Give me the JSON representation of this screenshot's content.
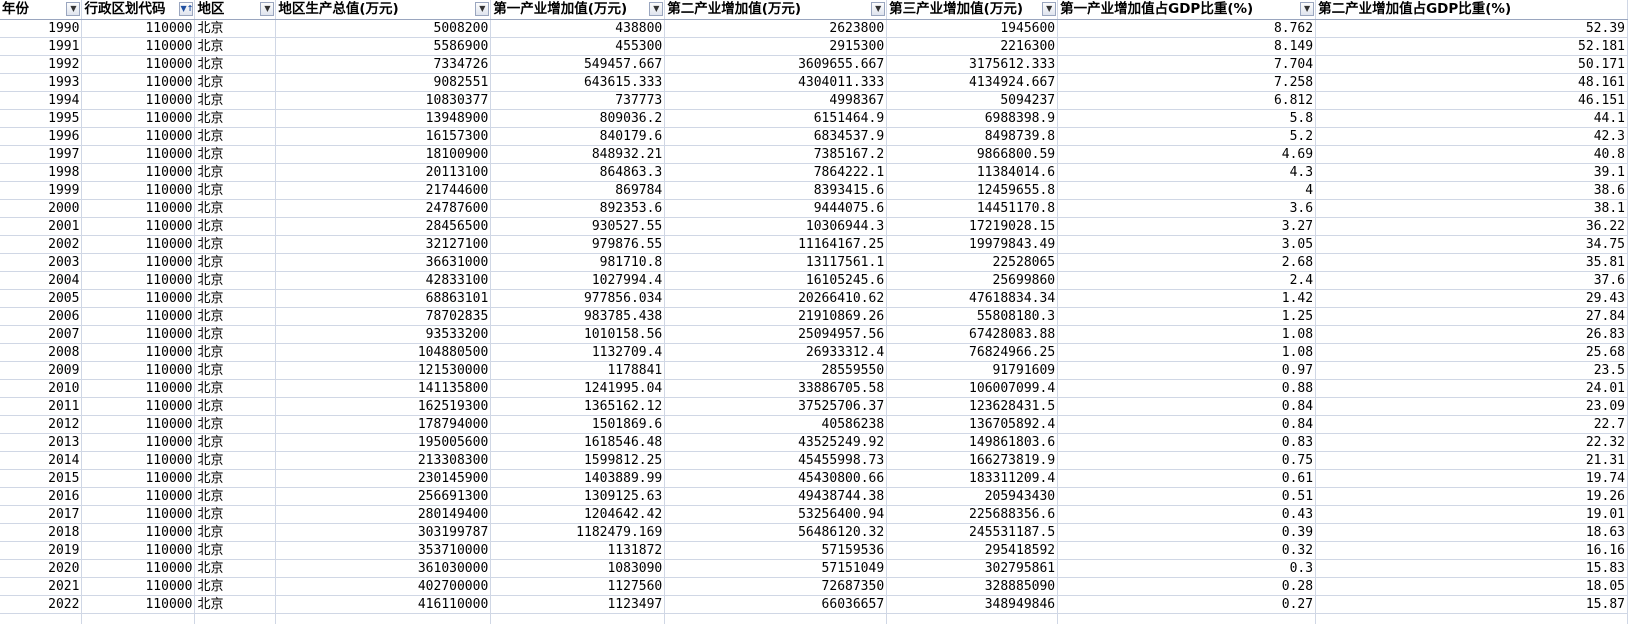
{
  "sheet": {
    "headers": [
      {
        "label": "年份",
        "filter_icon": "filter-dropdown-icon"
      },
      {
        "label": "行政区划代码",
        "filter_icon": "sort-filter-icon"
      },
      {
        "label": "地区",
        "filter_icon": "filter-dropdown-icon"
      },
      {
        "label": "地区生产总值(万元)",
        "filter_icon": "filter-dropdown-icon"
      },
      {
        "label": "第一产业增加值(万元)",
        "filter_icon": "filter-dropdown-icon"
      },
      {
        "label": "第二产业增加值(万元)",
        "filter_icon": "filter-dropdown-icon"
      },
      {
        "label": "第三产业增加值(万元)",
        "filter_icon": "filter-dropdown-icon"
      },
      {
        "label": "第一产业增加值占GDP比重(%)",
        "filter_icon": "filter-dropdown-icon"
      },
      {
        "label": "第二产业增加值占GDP比重(%)",
        "filter_icon": ""
      }
    ],
    "rows": [
      [
        "1990",
        "110000",
        "北京",
        "5008200",
        "438800",
        "2623800",
        "1945600",
        "8.762",
        "52.39"
      ],
      [
        "1991",
        "110000",
        "北京",
        "5586900",
        "455300",
        "2915300",
        "2216300",
        "8.149",
        "52.181"
      ],
      [
        "1992",
        "110000",
        "北京",
        "7334726",
        "549457.667",
        "3609655.667",
        "3175612.333",
        "7.704",
        "50.171"
      ],
      [
        "1993",
        "110000",
        "北京",
        "9082551",
        "643615.333",
        "4304011.333",
        "4134924.667",
        "7.258",
        "48.161"
      ],
      [
        "1994",
        "110000",
        "北京",
        "10830377",
        "737773",
        "4998367",
        "5094237",
        "6.812",
        "46.151"
      ],
      [
        "1995",
        "110000",
        "北京",
        "13948900",
        "809036.2",
        "6151464.9",
        "6988398.9",
        "5.8",
        "44.1"
      ],
      [
        "1996",
        "110000",
        "北京",
        "16157300",
        "840179.6",
        "6834537.9",
        "8498739.8",
        "5.2",
        "42.3"
      ],
      [
        "1997",
        "110000",
        "北京",
        "18100900",
        "848932.21",
        "7385167.2",
        "9866800.59",
        "4.69",
        "40.8"
      ],
      [
        "1998",
        "110000",
        "北京",
        "20113100",
        "864863.3",
        "7864222.1",
        "11384014.6",
        "4.3",
        "39.1"
      ],
      [
        "1999",
        "110000",
        "北京",
        "21744600",
        "869784",
        "8393415.6",
        "12459655.8",
        "4",
        "38.6"
      ],
      [
        "2000",
        "110000",
        "北京",
        "24787600",
        "892353.6",
        "9444075.6",
        "14451170.8",
        "3.6",
        "38.1"
      ],
      [
        "2001",
        "110000",
        "北京",
        "28456500",
        "930527.55",
        "10306944.3",
        "17219028.15",
        "3.27",
        "36.22"
      ],
      [
        "2002",
        "110000",
        "北京",
        "32127100",
        "979876.55",
        "11164167.25",
        "19979843.49",
        "3.05",
        "34.75"
      ],
      [
        "2003",
        "110000",
        "北京",
        "36631000",
        "981710.8",
        "13117561.1",
        "22528065",
        "2.68",
        "35.81"
      ],
      [
        "2004",
        "110000",
        "北京",
        "42833100",
        "1027994.4",
        "16105245.6",
        "25699860",
        "2.4",
        "37.6"
      ],
      [
        "2005",
        "110000",
        "北京",
        "68863101",
        "977856.034",
        "20266410.62",
        "47618834.34",
        "1.42",
        "29.43"
      ],
      [
        "2006",
        "110000",
        "北京",
        "78702835",
        "983785.438",
        "21910869.26",
        "55808180.3",
        "1.25",
        "27.84"
      ],
      [
        "2007",
        "110000",
        "北京",
        "93533200",
        "1010158.56",
        "25094957.56",
        "67428083.88",
        "1.08",
        "26.83"
      ],
      [
        "2008",
        "110000",
        "北京",
        "104880500",
        "1132709.4",
        "26933312.4",
        "76824966.25",
        "1.08",
        "25.68"
      ],
      [
        "2009",
        "110000",
        "北京",
        "121530000",
        "1178841",
        "28559550",
        "91791609",
        "0.97",
        "23.5"
      ],
      [
        "2010",
        "110000",
        "北京",
        "141135800",
        "1241995.04",
        "33886705.58",
        "106007099.4",
        "0.88",
        "24.01"
      ],
      [
        "2011",
        "110000",
        "北京",
        "162519300",
        "1365162.12",
        "37525706.37",
        "123628431.5",
        "0.84",
        "23.09"
      ],
      [
        "2012",
        "110000",
        "北京",
        "178794000",
        "1501869.6",
        "40586238",
        "136705892.4",
        "0.84",
        "22.7"
      ],
      [
        "2013",
        "110000",
        "北京",
        "195005600",
        "1618546.48",
        "43525249.92",
        "149861803.6",
        "0.83",
        "22.32"
      ],
      [
        "2014",
        "110000",
        "北京",
        "213308300",
        "1599812.25",
        "45455998.73",
        "166273819.9",
        "0.75",
        "21.31"
      ],
      [
        "2015",
        "110000",
        "北京",
        "230145900",
        "1403889.99",
        "45430800.66",
        "183311209.4",
        "0.61",
        "19.74"
      ],
      [
        "2016",
        "110000",
        "北京",
        "256691300",
        "1309125.63",
        "49438744.38",
        "205943430",
        "0.51",
        "19.26"
      ],
      [
        "2017",
        "110000",
        "北京",
        "280149400",
        "1204642.42",
        "53256400.94",
        "225688356.6",
        "0.43",
        "19.01"
      ],
      [
        "2018",
        "110000",
        "北京",
        "303199787",
        "1182479.169",
        "56486120.32",
        "245531187.5",
        "0.39",
        "18.63"
      ],
      [
        "2019",
        "110000",
        "北京",
        "353710000",
        "1131872",
        "57159536",
        "295418592",
        "0.32",
        "16.16"
      ],
      [
        "2020",
        "110000",
        "北京",
        "361030000",
        "1083090",
        "57151049",
        "302795861",
        "0.3",
        "15.83"
      ],
      [
        "2021",
        "110000",
        "北京",
        "402700000",
        "1127560",
        "72687350",
        "328885090",
        "0.28",
        "18.05"
      ],
      [
        "2022",
        "110000",
        "北京",
        "416110000",
        "1123497",
        "66036657",
        "348949846",
        "0.27",
        "15.87"
      ]
    ]
  }
}
